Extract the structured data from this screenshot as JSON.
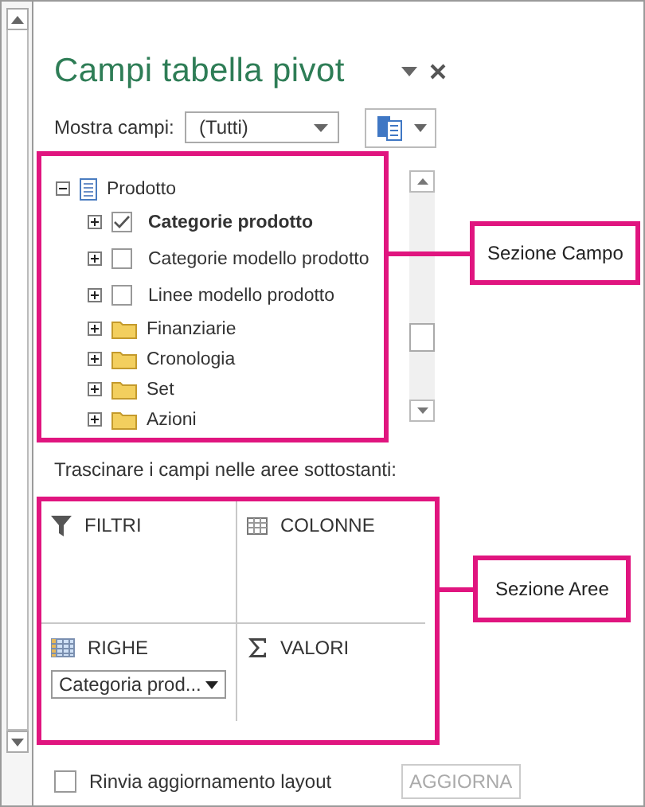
{
  "panel": {
    "title": "Campi tabella pivot",
    "show_fields_label": "Mostra campi:",
    "show_fields_value": "(Tutti)"
  },
  "field_list": [
    {
      "label": "Prodotto",
      "kind": "table",
      "expanded": true,
      "children": [
        {
          "label": "Categorie prodotto",
          "kind": "field",
          "expanded": false,
          "checked": true
        },
        {
          "label": "Categorie modello prodotto",
          "kind": "field",
          "expanded": false,
          "checked": false
        },
        {
          "label": "Linee modello prodotto",
          "kind": "field",
          "expanded": false,
          "checked": false
        },
        {
          "label": "Finanziarie",
          "kind": "folder",
          "expanded": false
        },
        {
          "label": "Cronologia",
          "kind": "folder",
          "expanded": false
        },
        {
          "label": "Set",
          "kind": "folder",
          "expanded": false
        },
        {
          "label": "Azioni",
          "kind": "folder",
          "expanded": false
        }
      ]
    }
  ],
  "areas_hint": "Trascinare i campi nelle aree sottostanti:",
  "areas": [
    {
      "label": "FILTRI",
      "kind": "filters"
    },
    {
      "label": "COLONNE",
      "kind": "columns"
    },
    {
      "label": "RIGHE",
      "kind": "rows",
      "items": [
        "Categoria prod..."
      ]
    },
    {
      "label": "VALORI",
      "kind": "values"
    }
  ],
  "footer": {
    "defer_label": "Rinvia aggiornamento layout",
    "defer_checked": false,
    "update_button": "AGGIORNA",
    "update_disabled": true
  },
  "callouts": [
    {
      "label": "Sezione Campo"
    },
    {
      "label": "Sezione Aree"
    }
  ]
}
